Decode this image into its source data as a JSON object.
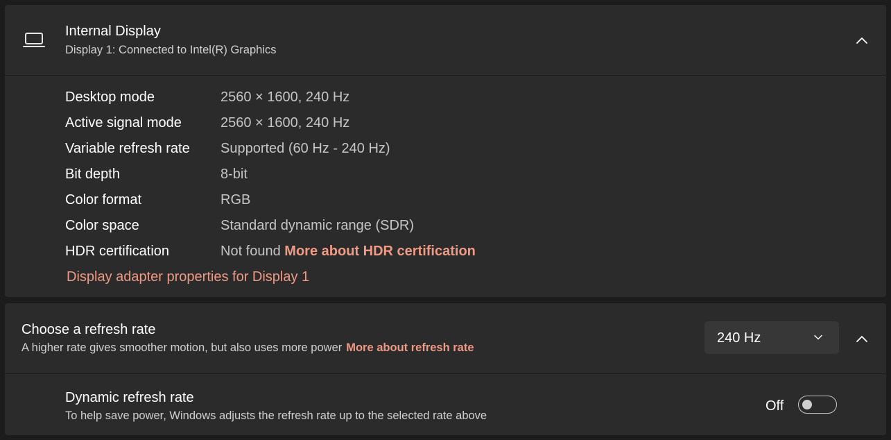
{
  "display": {
    "title": "Internal Display",
    "subtitle": "Display 1: Connected to Intel(R) Graphics",
    "icon": "laptop-icon",
    "expanded": true,
    "properties": [
      {
        "label": "Desktop mode",
        "value": "2560 × 1600, 240 Hz"
      },
      {
        "label": "Active signal mode",
        "value": "2560 × 1600, 240 Hz"
      },
      {
        "label": "Variable refresh rate",
        "value": "Supported (60 Hz - 240 Hz)"
      },
      {
        "label": "Bit depth",
        "value": "8-bit"
      },
      {
        "label": "Color format",
        "value": "RGB"
      },
      {
        "label": "Color space",
        "value": "Standard dynamic range (SDR)"
      },
      {
        "label": "HDR certification",
        "value": "Not found",
        "link": "More about HDR certification"
      }
    ],
    "adapter_link": "Display adapter properties for Display 1"
  },
  "refresh": {
    "title": "Choose a refresh rate",
    "subtitle": "A higher rate gives smoother motion, but also uses more power",
    "link": "More about refresh rate",
    "selected": "240 Hz",
    "expanded": true
  },
  "dynamic": {
    "title": "Dynamic refresh rate",
    "subtitle": "To help save power, Windows adjusts the refresh rate up to the selected rate above",
    "state_label": "Off",
    "enabled": false
  },
  "colors": {
    "accent_link": "#ee9a85",
    "card_bg": "#2b2b2b",
    "window_bg": "#1c1c1c"
  }
}
